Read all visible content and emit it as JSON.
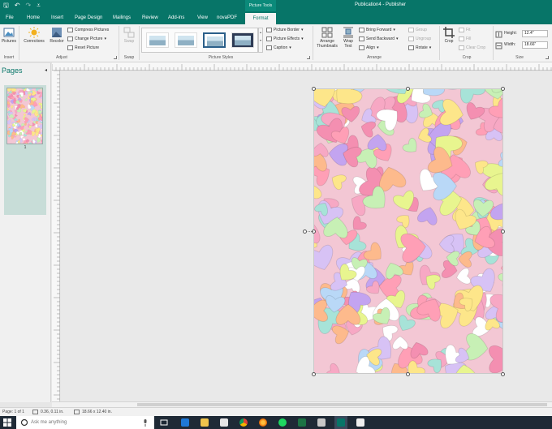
{
  "titlebar": {
    "context_tab_title": "Picture Tools",
    "document_title": "Publication4 - Publisher"
  },
  "tabs": [
    "File",
    "Home",
    "Insert",
    "Page Design",
    "Mailings",
    "Review",
    "Add-ins",
    "View",
    "novaPDF",
    "Format"
  ],
  "ribbon": {
    "insert": {
      "pictures": "Pictures",
      "group": "Insert"
    },
    "adjust": {
      "corrections": "Corrections",
      "recolor": "Recolor",
      "compress": "Compress Pictures",
      "change": "Change Picture",
      "reset": "Reset Picture",
      "group": "Adjust"
    },
    "swap": {
      "swap": "Swap",
      "group": "Swap"
    },
    "picture_styles": {
      "border": "Picture Border",
      "effects": "Picture Effects",
      "caption": "Caption",
      "group": "Picture Styles"
    },
    "arrange": {
      "arrange_thumbnails": "Arrange Thumbnails",
      "wrap_text": "Wrap Text",
      "bring_forward": "Bring Forward",
      "send_backward": "Send Backward",
      "align": "Align",
      "group_btn": "Group",
      "ungroup": "Ungroup",
      "rotate": "Rotate",
      "group": "Arrange"
    },
    "crop": {
      "crop": "Crop",
      "fit": "Fit",
      "fill": "Fill",
      "clear_crop": "Clear Crop",
      "group": "Crop"
    },
    "size": {
      "height_label": "Height:",
      "height_value": "12.4\"",
      "width_label": "Width:",
      "width_value": "18.66\"",
      "group": "Size"
    }
  },
  "pages_pane": {
    "title": "Pages",
    "collapse_glyph": "◂",
    "page_number": "1"
  },
  "status": {
    "page": "Page: 1 of 1",
    "position": "0.36, 0.11 in.",
    "size": "18.66 x 12.40 in."
  },
  "taskbar": {
    "search_placeholder": "Ask me anything"
  },
  "colors": {
    "accent": "#077568",
    "ribbon": "#f3f3f3",
    "taskbar": "#1f2a36"
  }
}
